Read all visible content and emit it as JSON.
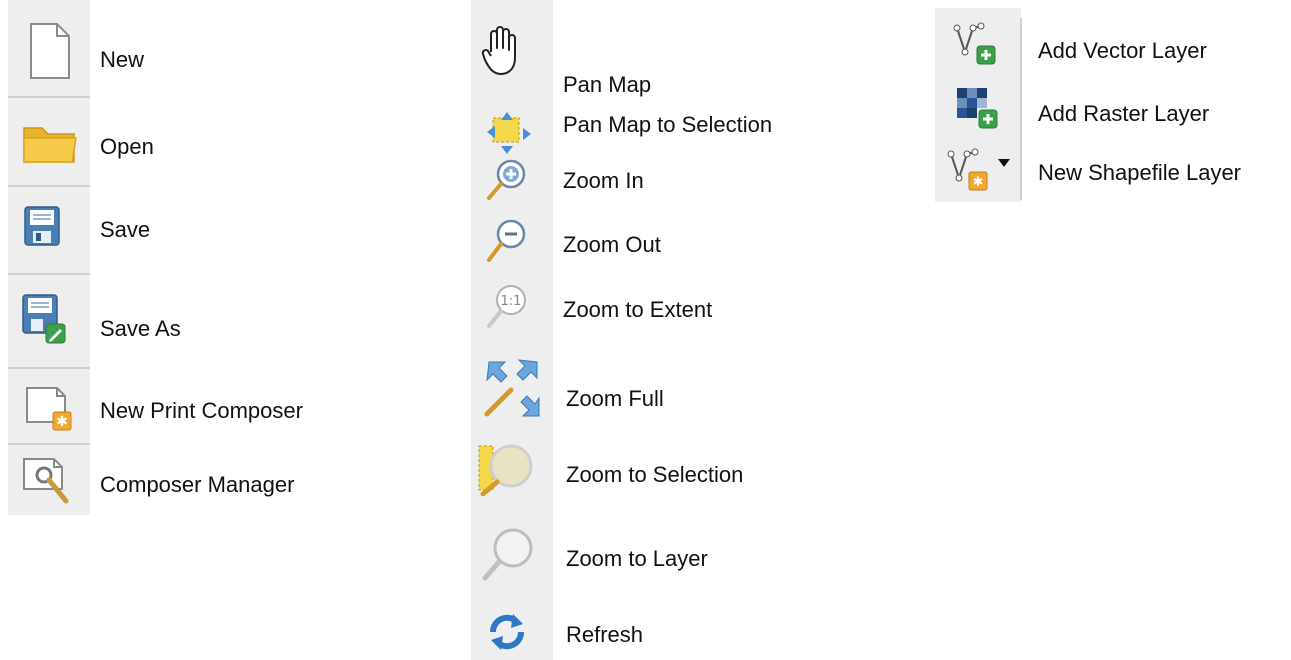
{
  "project_toolbar": {
    "items": [
      {
        "label": "New",
        "icon": "new-file-icon"
      },
      {
        "label": "Open",
        "icon": "folder-icon"
      },
      {
        "label": "Save",
        "icon": "save-icon"
      },
      {
        "label": "Save As",
        "icon": "save-as-icon"
      },
      {
        "label": "New Print Composer",
        "icon": "new-print-composer-icon"
      },
      {
        "label": "Composer Manager",
        "icon": "composer-manager-icon"
      }
    ]
  },
  "map_navigation_toolbar": {
    "items": [
      {
        "label": "Pan Map",
        "icon": "hand-pan-icon"
      },
      {
        "label": "Pan Map to Selection",
        "icon": "pan-to-selection-icon"
      },
      {
        "label": "Zoom In",
        "icon": "zoom-in-icon"
      },
      {
        "label": "Zoom Out",
        "icon": "zoom-out-icon"
      },
      {
        "label": "Zoom to Extent",
        "icon": "zoom-actual-size-icon"
      },
      {
        "label": "Zoom Full",
        "icon": "zoom-full-icon"
      },
      {
        "label": "Zoom to Selection",
        "icon": "zoom-to-selection-icon"
      },
      {
        "label": "Zoom to Layer",
        "icon": "zoom-to-layer-icon"
      },
      {
        "label": "Refresh",
        "icon": "refresh-icon"
      }
    ]
  },
  "layer_toolbar": {
    "items": [
      {
        "label": "Add Vector Layer",
        "icon": "add-vector-layer-icon"
      },
      {
        "label": "Add Raster Layer",
        "icon": "add-raster-layer-icon"
      },
      {
        "label": "New Shapefile Layer",
        "icon": "new-shapefile-layer-icon"
      }
    ]
  },
  "colors": {
    "tile_background": "#eeeeee",
    "folder_yellow": "#f7c948",
    "save_blue": "#4a7fb5",
    "accent_green": "#3aa14a",
    "accent_orange": "#f0a830",
    "refresh_blue": "#2f78c4"
  }
}
